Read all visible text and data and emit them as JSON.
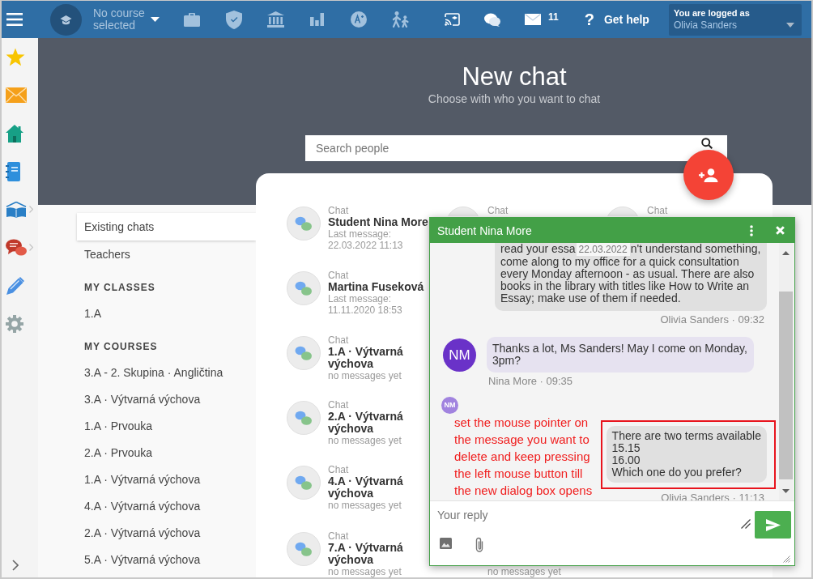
{
  "top_bar": {
    "course": "No course selected",
    "mail_count": "11",
    "help_icon": "?",
    "help": "Get help",
    "user_label": "You are logged as",
    "user_name": "Olivia Sanders"
  },
  "header": {
    "title": "New chat",
    "subtitle": "Choose with who you want to chat",
    "search_placeholder": "Search people"
  },
  "chat_nav": {
    "items": [
      {
        "label": "Existing chats",
        "selected": true
      },
      {
        "label": "Teachers",
        "selected": false
      }
    ],
    "sections": [
      {
        "heading": "MY CLASSES",
        "items": [
          {
            "label": "1.A",
            "selected": false
          }
        ]
      },
      {
        "heading": "MY COURSES",
        "items": [
          {
            "label": "3.A - 2. Skupina · Angličtina",
            "selected": false
          },
          {
            "label": "3.A · Výtvarná výchova",
            "selected": false
          },
          {
            "label": "1.A · Prvouka",
            "selected": false
          },
          {
            "label": "2.A · Prvouka",
            "selected": false
          },
          {
            "label": "1.A · Výtvarná výchova",
            "selected": false
          },
          {
            "label": "4.A · Výtvarná výchova",
            "selected": false
          },
          {
            "label": "2.A · Výtvarná výchova",
            "selected": false
          },
          {
            "label": "5.A · Výtvarná výchova",
            "selected": false
          }
        ]
      }
    ]
  },
  "chat_columns": [
    [
      {
        "label": "Chat",
        "name": "Student Nina More",
        "status": "Last message: 22.03.2022 11:13"
      },
      {
        "label": "Chat",
        "name": "Martina Fuseková",
        "status": "Last message: 11.11.2020 18:53"
      },
      {
        "label": "Chat",
        "name": "1.A · Výtvarná výchova",
        "status": "no messages yet"
      },
      {
        "label": "Chat",
        "name": "2.A · Výtvarná výchova",
        "status": "no messages yet"
      },
      {
        "label": "Chat",
        "name": "4.A · Výtvarná výchova",
        "status": "no messages yet"
      },
      {
        "label": "Chat",
        "name": "7.A · Výtvarná výchova",
        "status": "no messages yet"
      }
    ],
    [
      {
        "label": "Chat"
      },
      {
        "status": "no messages yet"
      }
    ],
    [
      {
        "label": "Chat"
      }
    ]
  ],
  "chat_window": {
    "title": "Student Nina More",
    "messages": [
      {
        "kind": "outgoing",
        "line_start": "read your essa",
        "date_separator": "22.03.2022",
        "line_end": "n't understand something,",
        "text": "come along to my office for a quick consultation every Monday afternoon - as usual. There are also books in the library with titles like How to Write an Essay; make use of them if needed.",
        "meta": "Olivia Sanders · 09:32",
        "highlighted": false
      },
      {
        "kind": "incoming",
        "initials": "NM",
        "text": "Thanks a lot, Ms Sanders! May I come on Monday, 3pm?",
        "meta": "Nina More · 09:35",
        "read_receipt": "NM",
        "highlighted": false
      },
      {
        "kind": "outgoing",
        "annotation": "set the mouse pointer on the message you want to delete and keep pressing the left mouse button till the new dialog box opens",
        "text": "There are two terms available\n15.15\n16.00\nWhich one do you prefer?",
        "meta": "Olivia Sanders · 11:13",
        "highlighted": true
      }
    ],
    "reply_placeholder": "Your reply"
  }
}
